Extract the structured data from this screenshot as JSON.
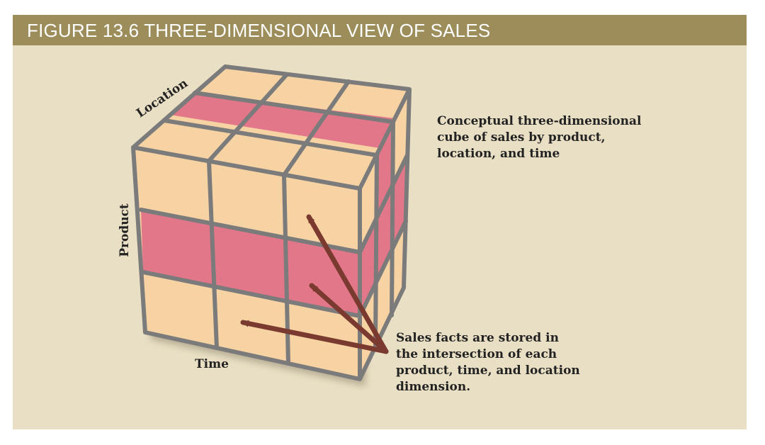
{
  "figure": {
    "title": "FIGURE 13.6  THREE-DIMENSIONAL VIEW OF SALES"
  },
  "axes": {
    "location": "Location",
    "product": "Product",
    "time": "Time"
  },
  "callouts": {
    "cube_description": [
      "Conceptual three-dimensional",
      "cube of sales by product,",
      "location, and time"
    ],
    "sales_facts": [
      "Sales facts are stored in",
      "the intersection of each",
      "product, time, and location",
      "dimension."
    ]
  },
  "colors": {
    "title_bar": "#9c8d5a",
    "panel_background": "#e9dfc4",
    "cell_peach": "#f7d3a4",
    "cell_pink": "#e3778a",
    "grid_line": "#7b7b7b",
    "arrow": "#7a3a30"
  }
}
